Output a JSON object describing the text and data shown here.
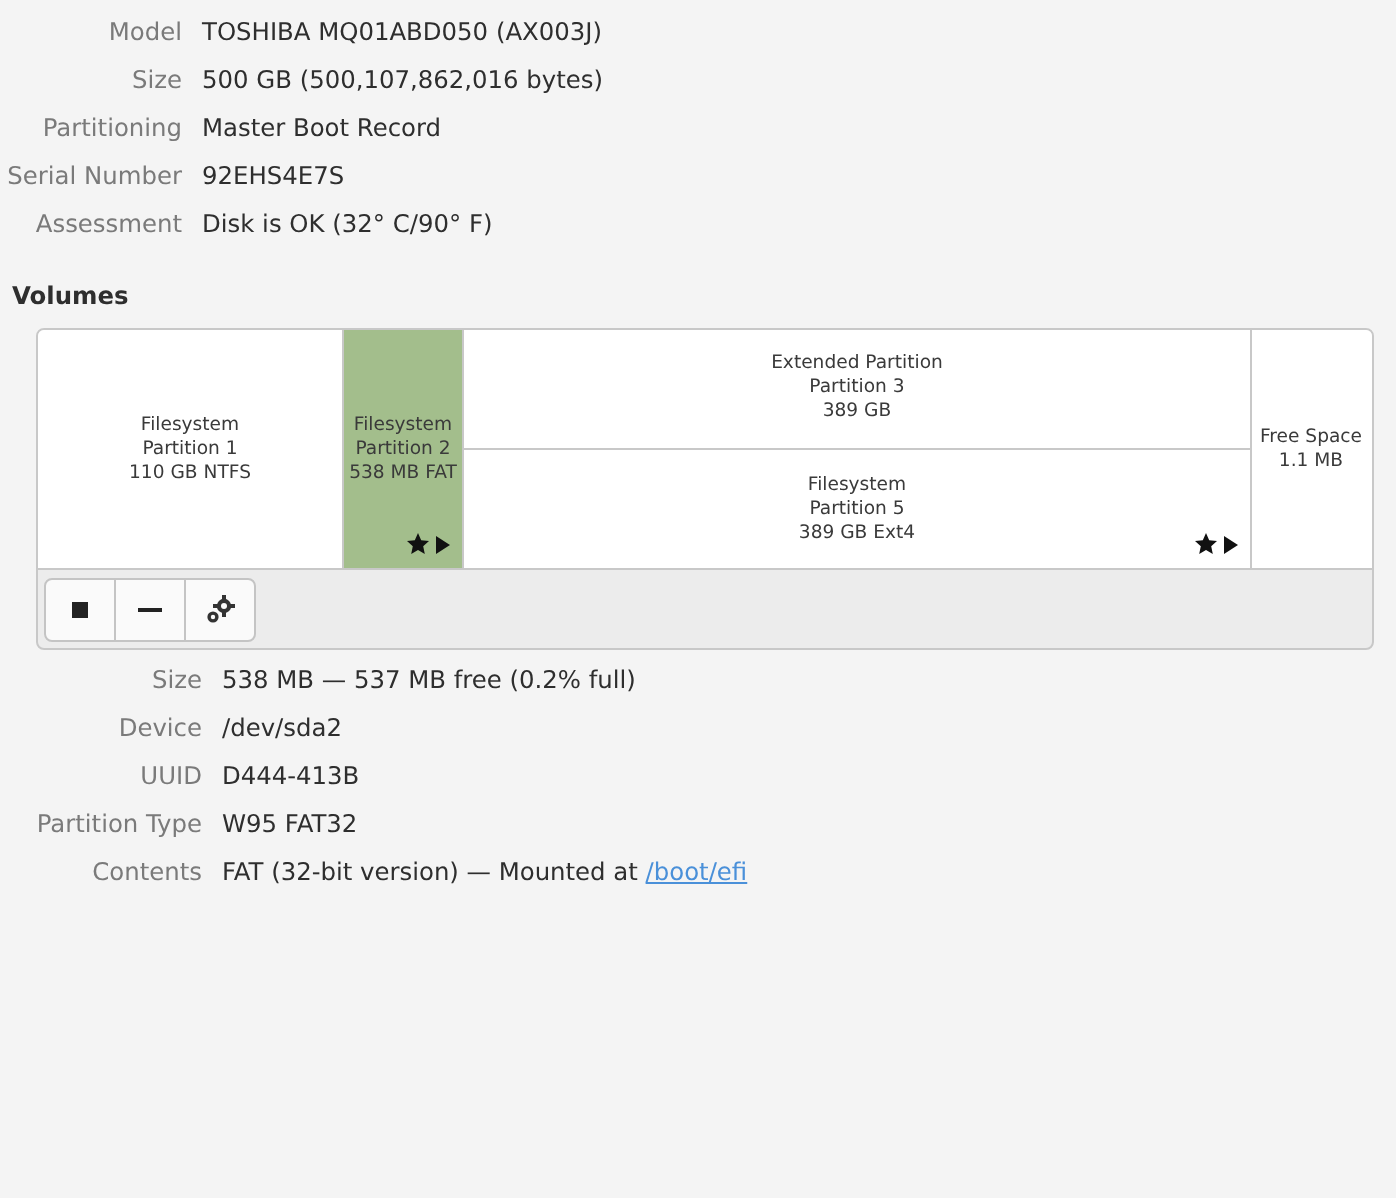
{
  "drive": [
    {
      "label": "Model",
      "value": "TOSHIBA MQ01ABD050 (AX003J)"
    },
    {
      "label": "Size",
      "value": "500 GB (500,107,862,016 bytes)"
    },
    {
      "label": "Partitioning",
      "value": "Master Boot Record"
    },
    {
      "label": "Serial Number",
      "value": "92EHS4E7S"
    },
    {
      "label": "Assessment",
      "value": "Disk is OK (32° C/90° F)"
    }
  ],
  "volumes_heading": "Volumes",
  "volumes": [
    {
      "kind": "partition",
      "lines": [
        "Filesystem",
        "Partition 1",
        "110 GB NTFS"
      ],
      "selected": false,
      "mounted": false
    },
    {
      "kind": "partition",
      "lines": [
        "Filesystem",
        "Partition 2",
        "538 MB FAT"
      ],
      "selected": true,
      "mounted": true
    },
    {
      "kind": "extended",
      "lines": [
        "Extended Partition",
        "Partition 3",
        "389 GB"
      ],
      "selected": false,
      "children": [
        {
          "kind": "partition",
          "lines": [
            "Filesystem",
            "Partition 5",
            "389 GB Ext4"
          ],
          "selected": false,
          "mounted": true
        }
      ]
    },
    {
      "kind": "free",
      "lines": [
        "Free Space",
        "1.1 MB"
      ],
      "selected": false
    }
  ],
  "toolbar": [
    {
      "kind": "stop"
    },
    {
      "kind": "minus"
    },
    {
      "kind": "gears"
    }
  ],
  "volume_details": [
    {
      "label": "Size",
      "value": "538 MB — 537 MB free (0.2% full)"
    },
    {
      "label": "Device",
      "value": "/dev/sda2"
    },
    {
      "label": "UUID",
      "value": "D444-413B"
    },
    {
      "label": "Partition Type",
      "value": "W95 FAT32"
    },
    {
      "label": "Contents",
      "value": "FAT (32-bit version) — Mounted at ",
      "link": "/boot/efi"
    }
  ]
}
